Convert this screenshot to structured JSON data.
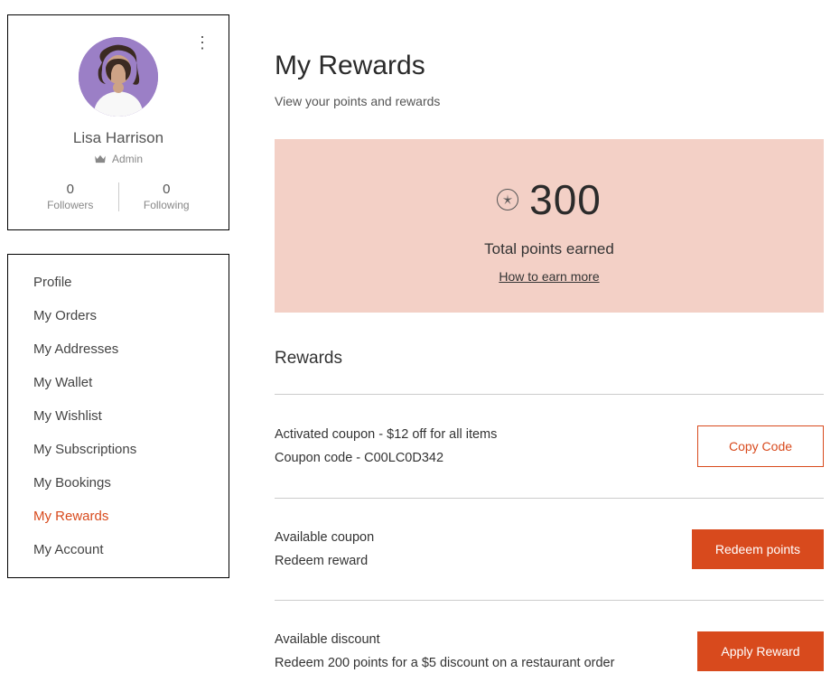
{
  "profile": {
    "name": "Lisa Harrison",
    "role": "Admin",
    "followers_count": "0",
    "followers_label": "Followers",
    "following_count": "0",
    "following_label": "Following"
  },
  "nav": {
    "items": [
      {
        "label": "Profile"
      },
      {
        "label": "My Orders"
      },
      {
        "label": "My Addresses"
      },
      {
        "label": "My Wallet"
      },
      {
        "label": "My Wishlist"
      },
      {
        "label": "My Subscriptions"
      },
      {
        "label": "My Bookings"
      },
      {
        "label": "My Rewards"
      },
      {
        "label": "My Account"
      }
    ],
    "active_index": 7
  },
  "header": {
    "title": "My Rewards",
    "subtitle": "View your points and rewards"
  },
  "points": {
    "value": "300",
    "label": "Total points earned",
    "link": "How to earn more"
  },
  "rewards": {
    "heading": "Rewards",
    "items": [
      {
        "title": "Activated coupon - $12 off for all items",
        "sub": "Coupon code - C00LC0D342",
        "button": "Copy Code",
        "button_style": "outline"
      },
      {
        "title": "Available coupon",
        "sub": "Redeem reward",
        "button": "Redeem points",
        "button_style": "solid"
      },
      {
        "title": "Available discount",
        "sub": "Redeem 200 points for a $5 discount on a restaurant order",
        "button": "Apply Reward",
        "button_style": "solid"
      }
    ]
  }
}
